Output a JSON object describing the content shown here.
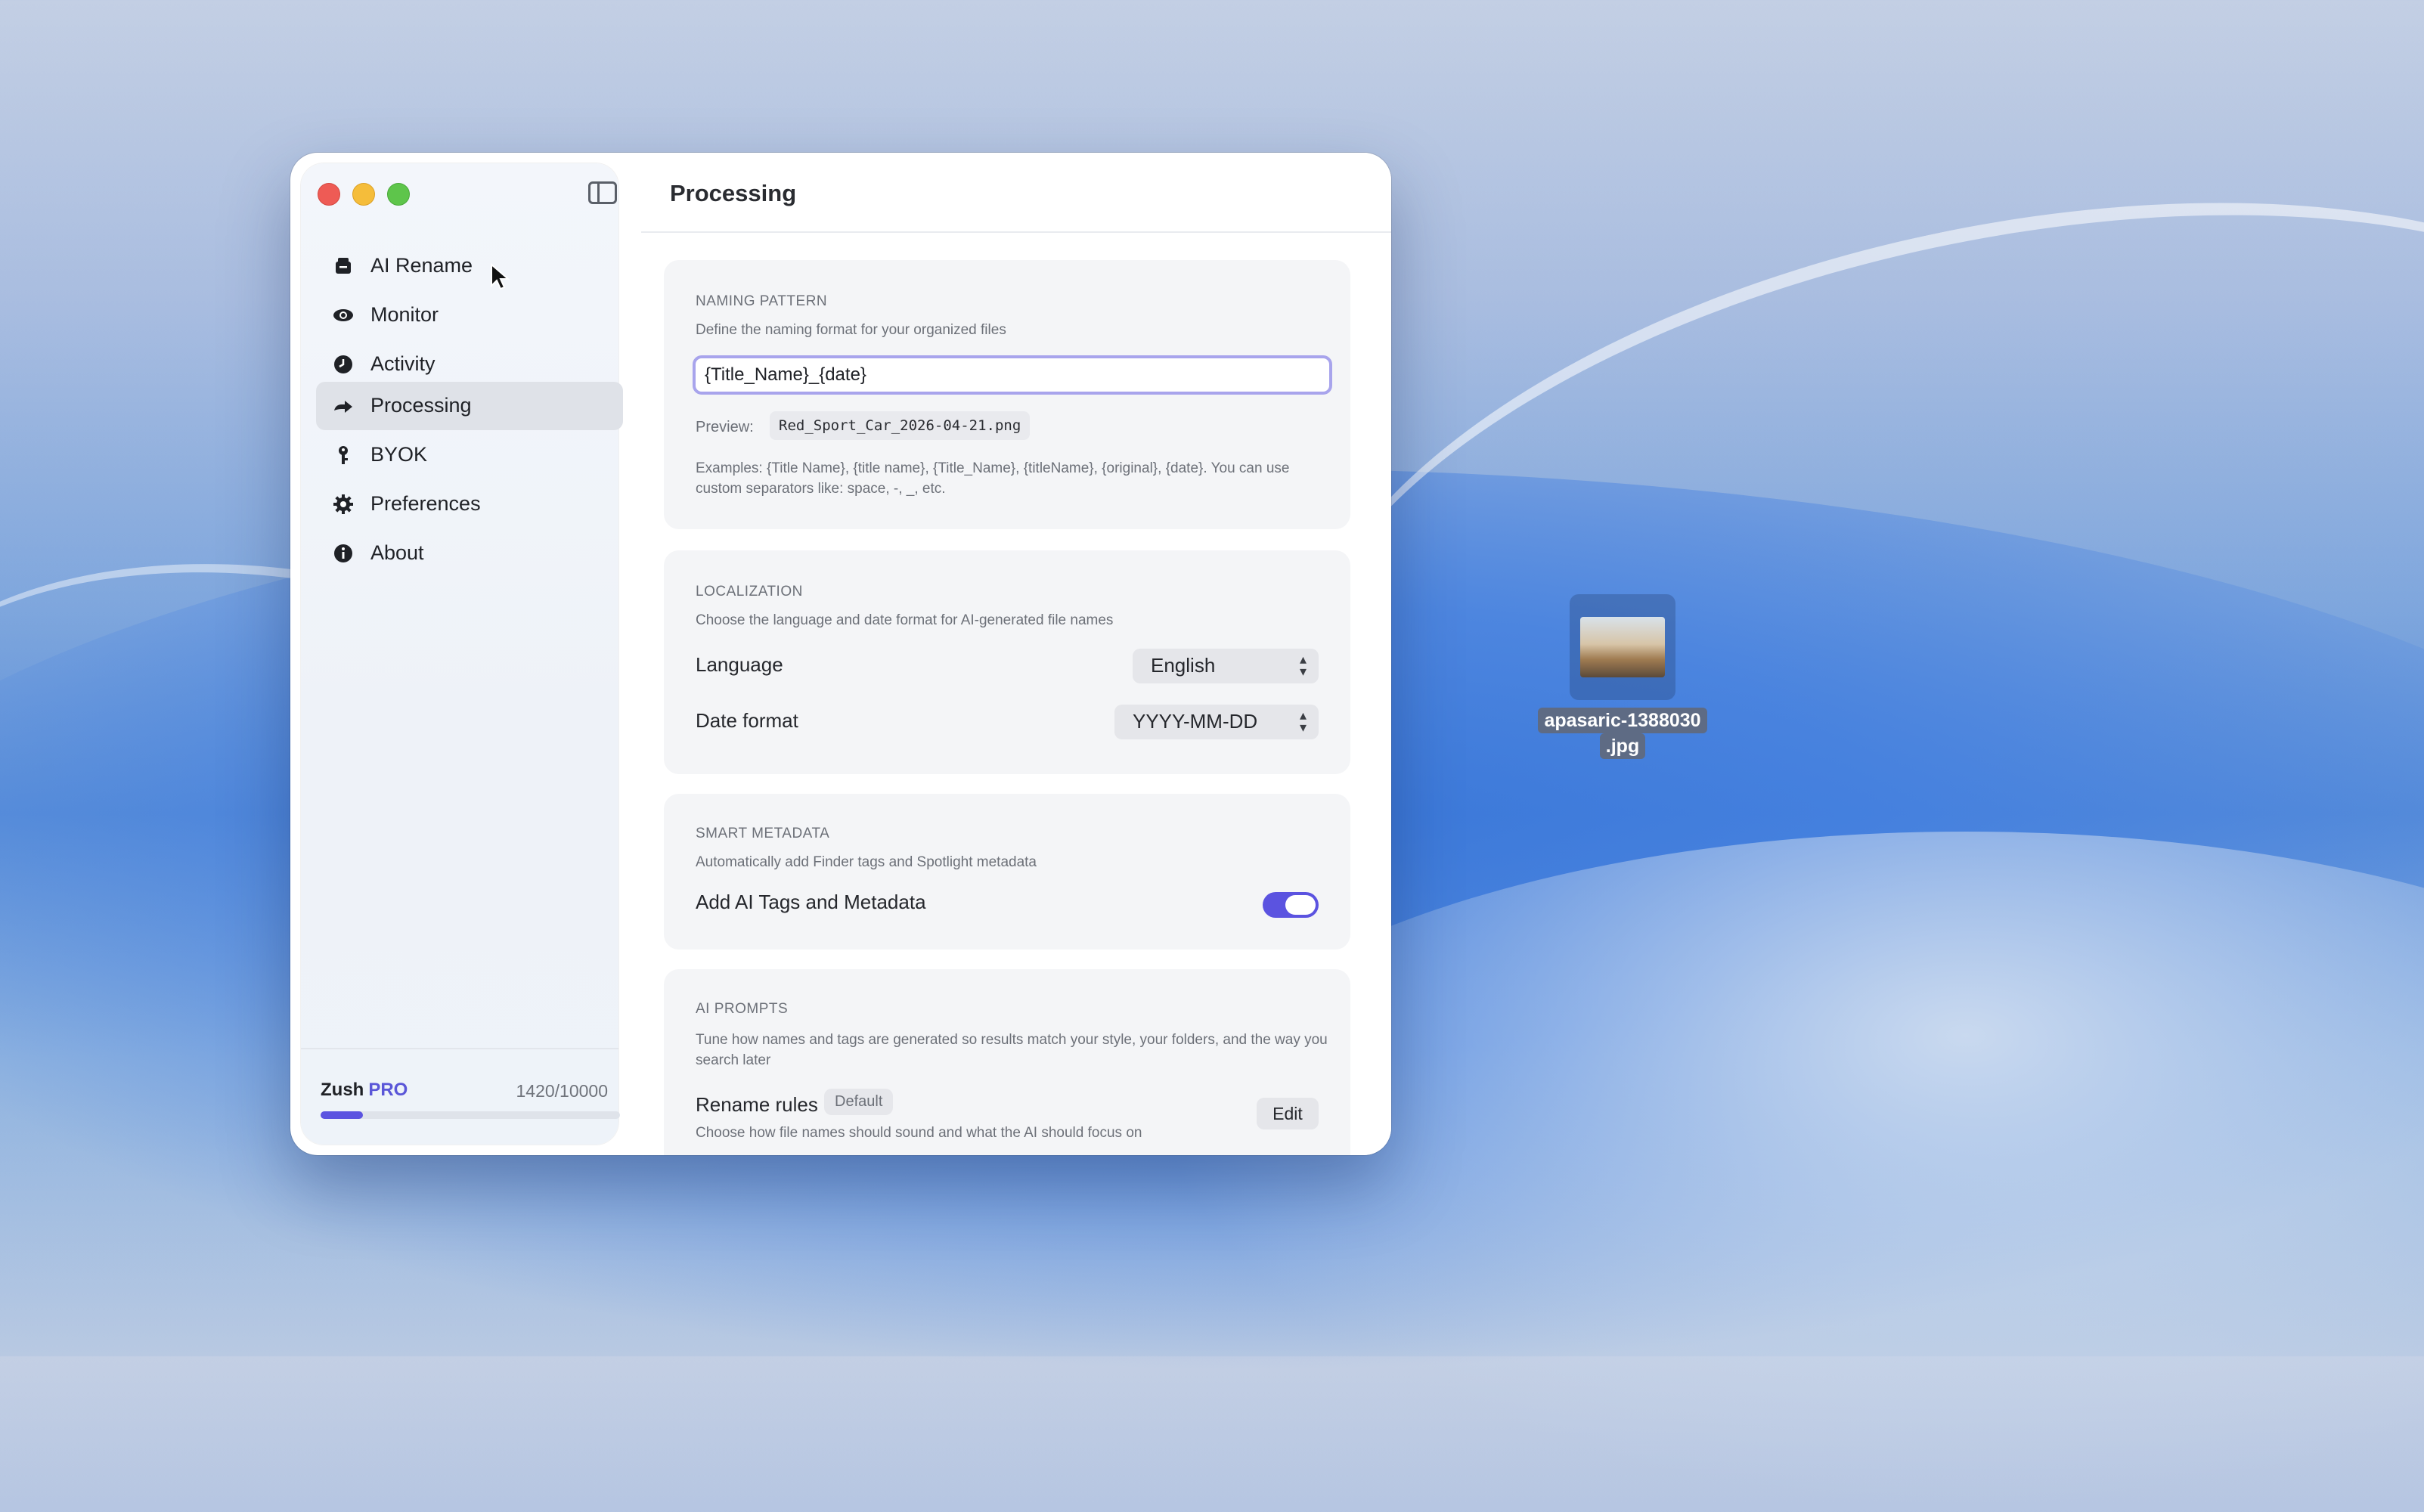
{
  "window": {
    "title": "Processing"
  },
  "sidebar": {
    "items": [
      {
        "label": "AI Rename",
        "icon": "ai-rename-icon"
      },
      {
        "label": "Monitor",
        "icon": "eye-icon"
      },
      {
        "label": "Activity",
        "icon": "clock-icon"
      },
      {
        "label": "Processing",
        "icon": "processing-icon",
        "active": true
      },
      {
        "label": "BYOK",
        "icon": "key-icon"
      },
      {
        "label": "Preferences",
        "icon": "gear-icon"
      },
      {
        "label": "About",
        "icon": "info-icon"
      }
    ],
    "usage": {
      "app_name": "Zush",
      "plan": "PRO",
      "count": "1420/10000",
      "fraction": 0.142
    }
  },
  "naming_pattern": {
    "title": "NAMING PATTERN",
    "description": "Define the naming format for your organized files",
    "value": "{Title_Name}_{date}",
    "preview_label": "Preview:",
    "preview_value": "Red_Sport_Car_2026-04-21.png",
    "examples": "Examples: {Title Name}, {title name}, {Title_Name}, {titleName}, {original}, {date}. You can use custom separators like: space, -, _, etc."
  },
  "localization": {
    "title": "LOCALIZATION",
    "description": "Choose the language and date format for AI-generated file names",
    "language_label": "Language",
    "language_value": "English",
    "date_format_label": "Date format",
    "date_format_value": "YYYY-MM-DD"
  },
  "smart_metadata": {
    "title": "SMART METADATA",
    "description": "Automatically add Finder tags and Spotlight metadata",
    "toggle_label": "Add AI Tags and Metadata",
    "toggle_on": true
  },
  "ai_prompts": {
    "title": "AI PROMPTS",
    "description": "Tune how names and tags are generated so results match your style, your folders, and the way you search later",
    "rename_rules_label": "Rename rules",
    "rename_rules_badge": "Default",
    "rename_rules_desc": "Choose how file names should sound and what the AI should focus on",
    "edit_label": "Edit"
  },
  "desktop": {
    "file_name_line1": "apasaric-1388030",
    "file_name_line2": ".jpg"
  },
  "colors": {
    "accent": "#5b53e0",
    "focus_ring": "#a8a4ec",
    "close": "#ee5b55",
    "minimize": "#f5bd3a",
    "maximize": "#5ec54b"
  }
}
